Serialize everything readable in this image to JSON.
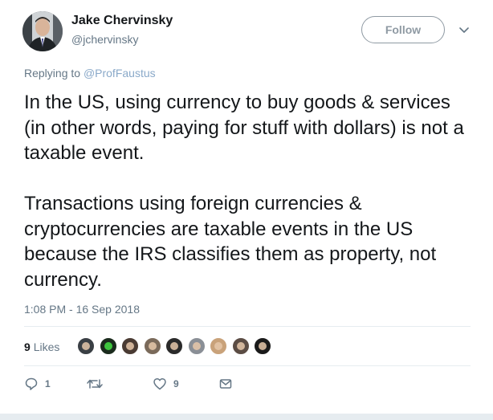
{
  "author": {
    "name": "Jake Chervinsky",
    "handle": "@jchervinsky"
  },
  "follow_label": "Follow",
  "reply_prefix": "Replying to",
  "reply_mention": "@ProfFaustus",
  "body": {
    "paragraph1": "In the US, using currency to buy goods & services (in other words, paying for stuff with dollars) is not a taxable event.",
    "paragraph2": "Transactions using foreign currencies & cryptocurrencies are taxable events in the US because the IRS classifies them as property, not currency."
  },
  "timestamp": "1:08 PM - 16 Sep 2018",
  "likes": {
    "count": "9",
    "label": "Likes",
    "liker_colors": [
      "#3a3f44",
      "#1b2b1d",
      "#4a3b33",
      "#7a6a5a",
      "#2a2a2a",
      "#8a8f96",
      "#c9a27a",
      "#5b4c44",
      "#1a1a1a"
    ]
  },
  "actions": {
    "reply_count": "1",
    "retweet_count": "",
    "like_count": "9"
  },
  "colors": {
    "secondary_text": "#657786",
    "mention": "#8aa9c9",
    "divider": "#e6ecf0"
  }
}
